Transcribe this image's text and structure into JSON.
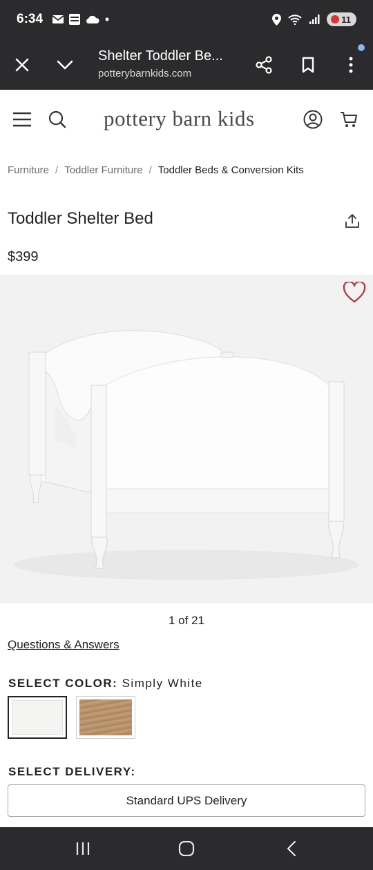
{
  "status_bar": {
    "time": "6:34",
    "battery": "11",
    "icons": [
      "gmail-icon",
      "fox-news-icon",
      "cloud-icon",
      "dot-icon",
      "location-icon",
      "wifi-icon",
      "signal-icon",
      "battery-icon"
    ]
  },
  "browser": {
    "title": "Shelter Toddler Be...",
    "url": "potterybarnkids.com"
  },
  "site": {
    "logo": "pottery barn kids"
  },
  "breadcrumb": {
    "items": [
      "Furniture",
      "Toddler Furniture",
      "Toddler Beds & Conversion Kits"
    ],
    "separator": "/"
  },
  "product": {
    "title": "Toddler Shelter Bed",
    "price": "$399",
    "image_counter": "1 of 21",
    "qa_link": "Questions & Answers"
  },
  "color": {
    "label": "SELECT COLOR:",
    "selected": "Simply White",
    "swatches": [
      {
        "name": "Simply White",
        "color": "#f4f4f2",
        "selected": true
      },
      {
        "name": "Natural Wood",
        "color": "#b8916a",
        "selected": false
      }
    ]
  },
  "delivery": {
    "label": "SELECT DELIVERY:",
    "selected": "Standard UPS Delivery"
  },
  "colors": {
    "system_bar": "#2b2b2d",
    "heart": "#b03040",
    "image_bg": "#f2f2f2"
  }
}
